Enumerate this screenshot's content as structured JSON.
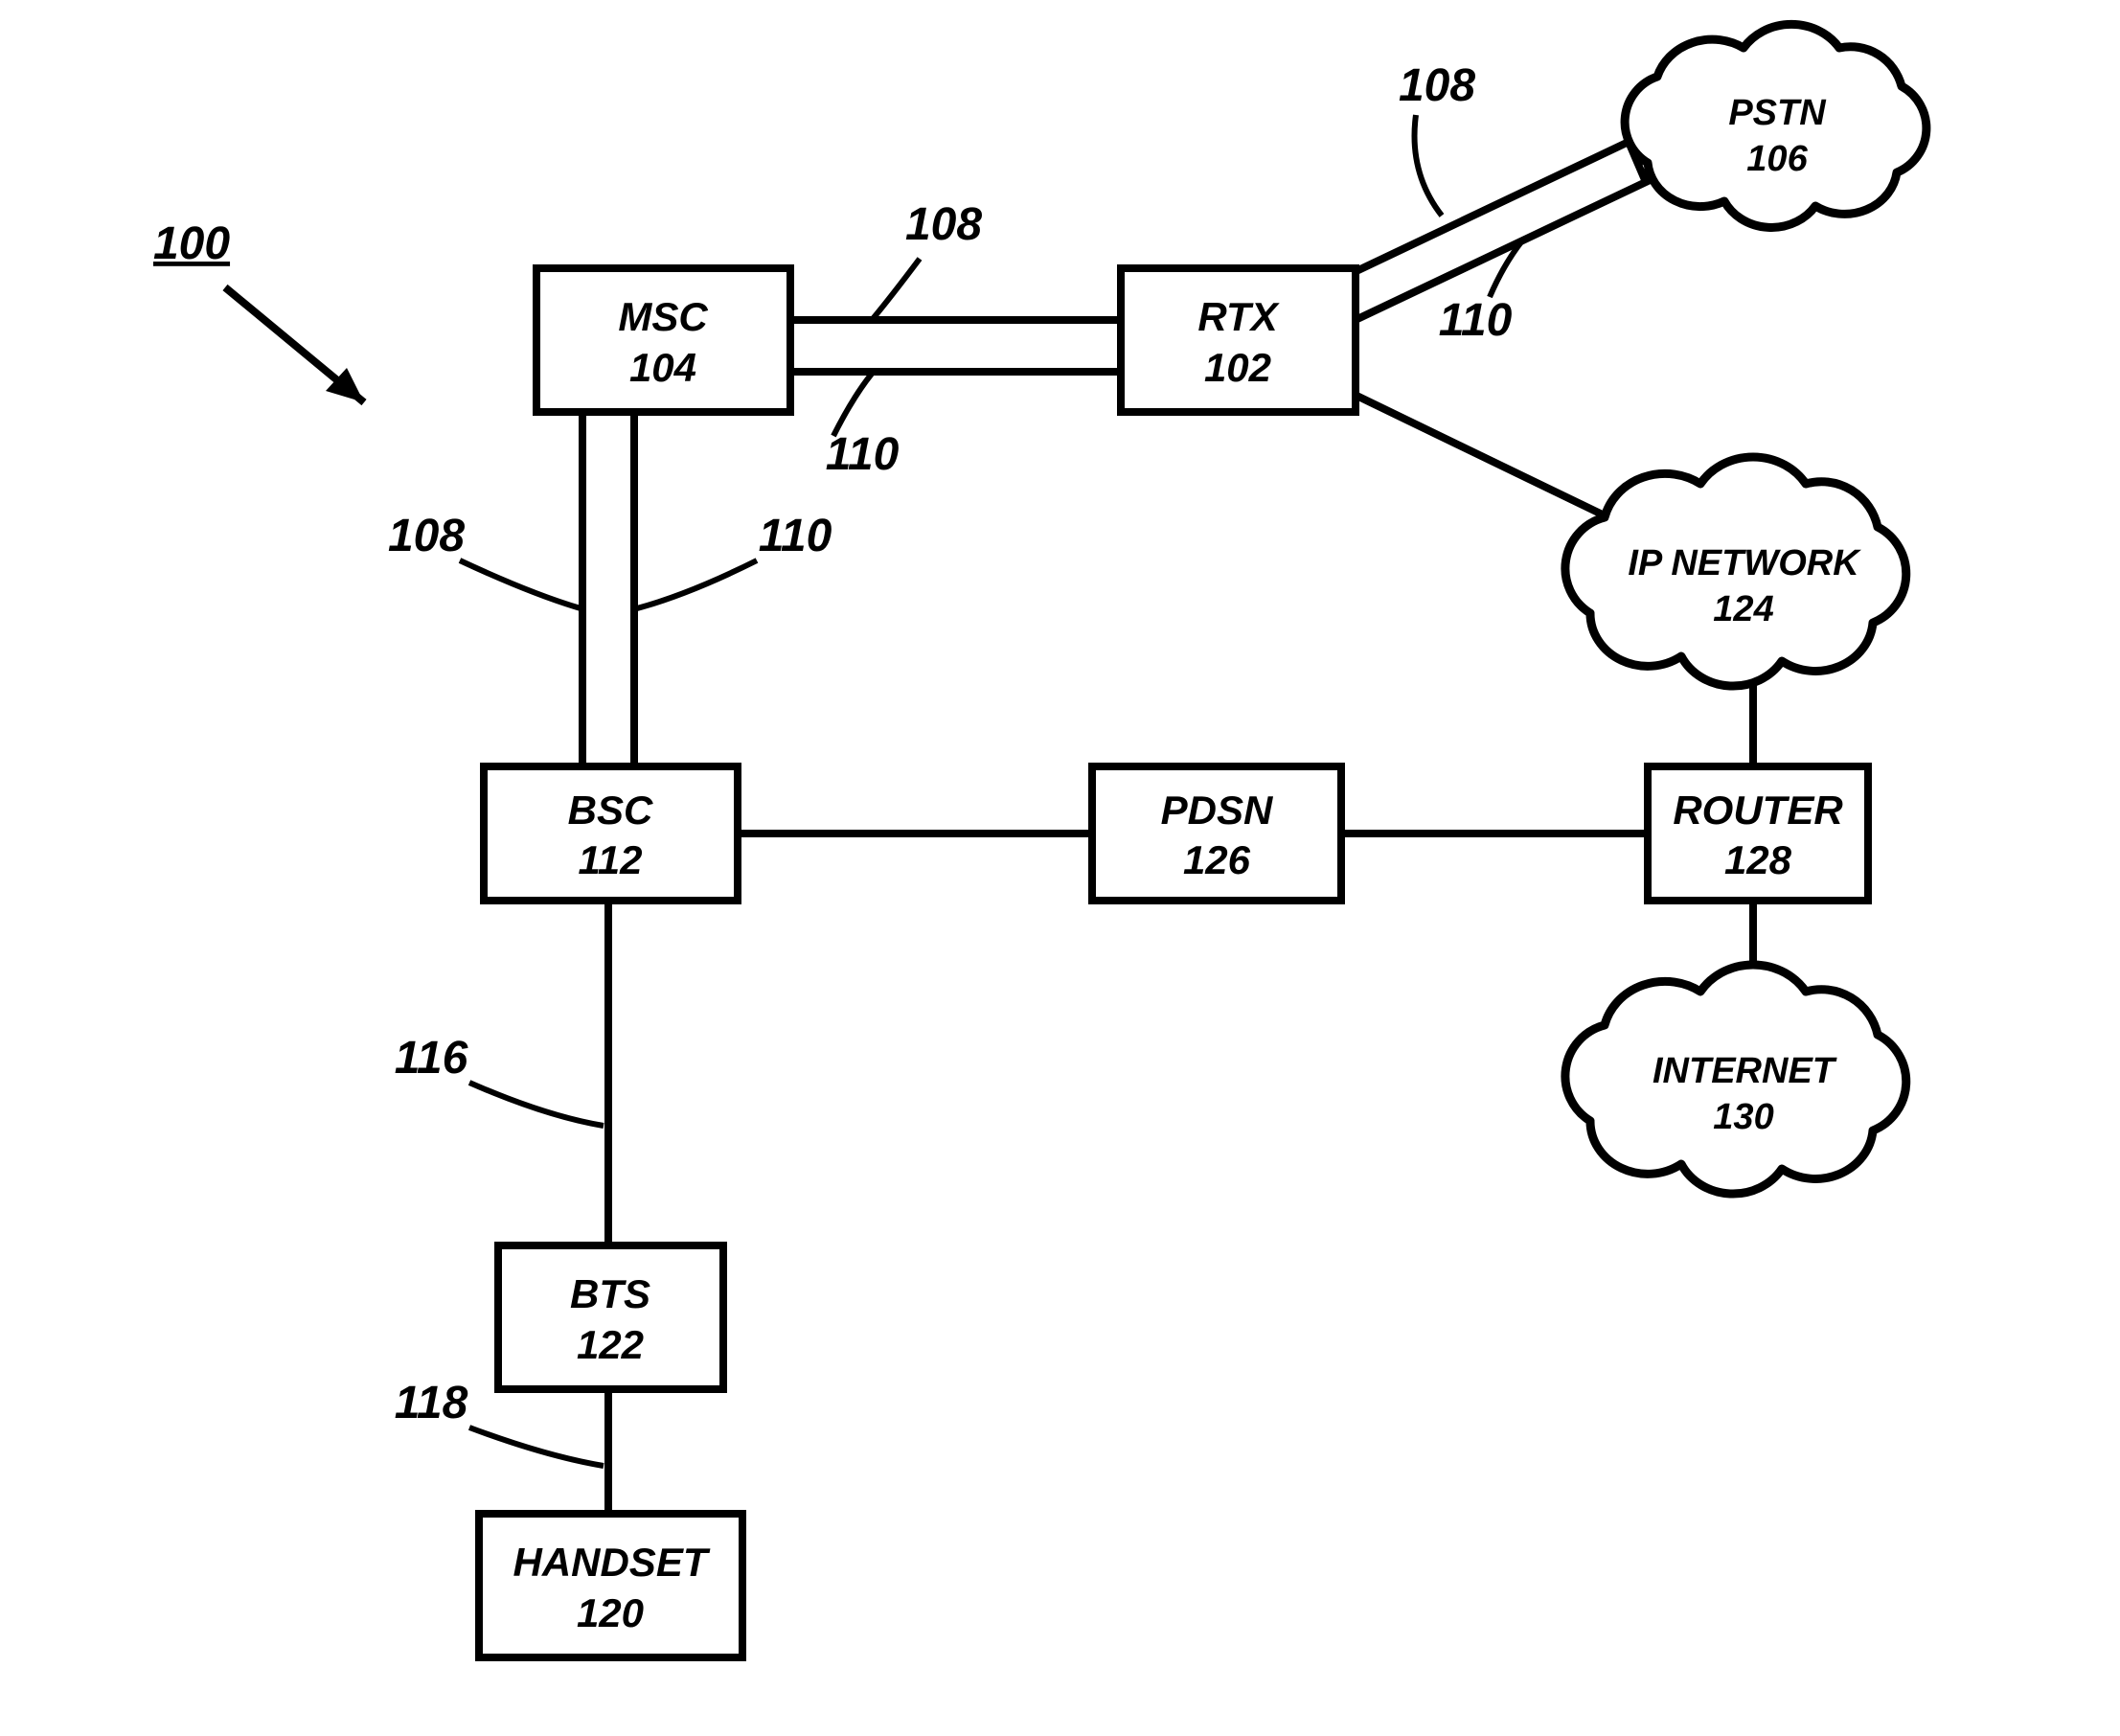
{
  "diagram": {
    "figure_ref": "100",
    "nodes": {
      "msc": {
        "name": "MSC",
        "num": "104"
      },
      "rtx": {
        "name": "RTX",
        "num": "102"
      },
      "pstn": {
        "name": "PSTN",
        "num": "106"
      },
      "ipnet": {
        "name": "IP NETWORK",
        "num": "124"
      },
      "bsc": {
        "name": "BSC",
        "num": "112"
      },
      "pdsn": {
        "name": "PDSN",
        "num": "126"
      },
      "router": {
        "name": "ROUTER",
        "num": "128"
      },
      "internet": {
        "name": "INTERNET",
        "num": "130"
      },
      "bts": {
        "name": "BTS",
        "num": "122"
      },
      "handset": {
        "name": "HANDSET",
        "num": "120"
      }
    },
    "link_refs": {
      "l108a": "108",
      "l110a": "110",
      "l108b": "108",
      "l110b": "110",
      "l108c": "108",
      "l110c": "110",
      "l116": "116",
      "l118": "118"
    }
  }
}
